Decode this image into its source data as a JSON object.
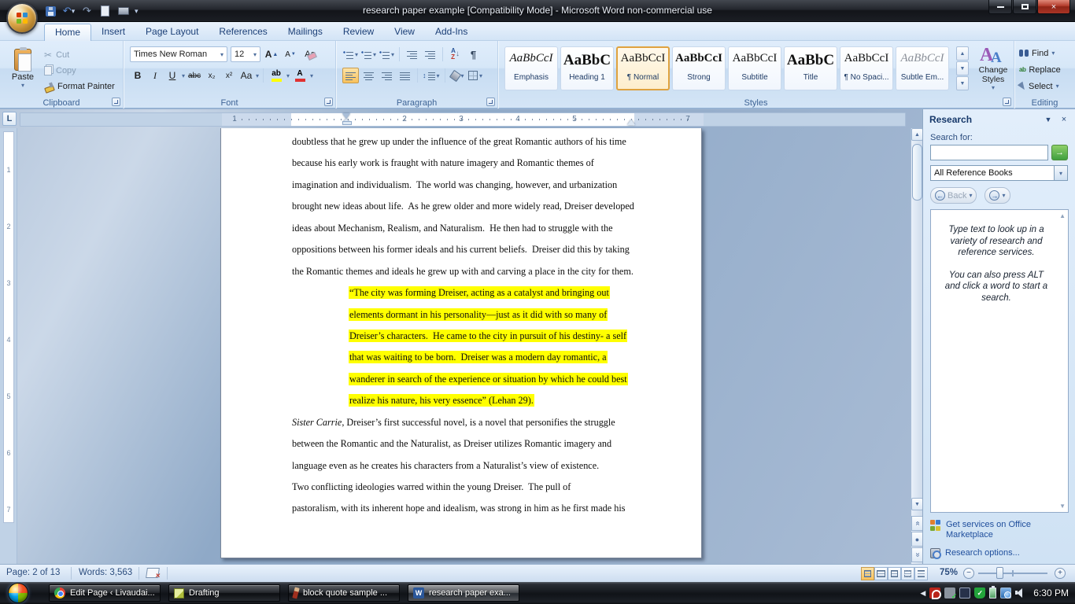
{
  "titlebar": {
    "title": "research paper example [Compatibility Mode] - Microsoft Word non-commercial use"
  },
  "window_controls": {
    "close": "×"
  },
  "icons": {
    "office-button": "office-orb",
    "save": "floppy-disk",
    "undo": "↶",
    "redo": "↷",
    "find": "binoculars",
    "select": "cursor-arrow",
    "go-search": "→",
    "highlight": "ab + yellow bar",
    "font_color": "A + red bar",
    "pilcrow": "¶"
  },
  "ribbon": {
    "tabs": [
      "Home",
      "Insert",
      "Page Layout",
      "References",
      "Mailings",
      "Review",
      "View",
      "Add-Ins"
    ],
    "clipboard": {
      "label": "Clipboard",
      "paste": "Paste",
      "cut": "Cut",
      "copy": "Copy",
      "format_painter": "Format Painter"
    },
    "font": {
      "label": "Font",
      "family": "Times New Roman",
      "size": "12",
      "bold": "B",
      "italic": "I",
      "underline": "U",
      "strike": "abc",
      "subscript": "x₂",
      "superscript": "x²",
      "change_case": "Aa",
      "highlight": "ab",
      "font_color": "A"
    },
    "paragraph": {
      "label": "Paragraph",
      "sort_a": "A",
      "sort_z": "Z",
      "pilcrow": "¶"
    },
    "styles": {
      "label": "Styles",
      "items": [
        {
          "preview": "AaBbCcI",
          "label": "Emphasis"
        },
        {
          "preview": "AaBbC",
          "label": "Heading 1"
        },
        {
          "preview": "AaBbCcI",
          "label": "¶ Normal"
        },
        {
          "preview": "AaBbCcI",
          "label": "Strong"
        },
        {
          "preview": "AaBbCcI",
          "label": "Subtitle"
        },
        {
          "preview": "AaBbC",
          "label": "Title"
        },
        {
          "preview": "AaBbCcI",
          "label": "¶ No Spaci..."
        },
        {
          "preview": "AaBbCcI",
          "label": "Subtle Em..."
        }
      ]
    },
    "change_styles": "Change Styles",
    "editing": {
      "label": "Editing",
      "find": "Find",
      "replace": "Replace",
      "select": "Select"
    }
  },
  "ruler": {
    "tab_selector": "L",
    "h_numbers": [
      "1",
      "2",
      "3",
      "4",
      "5",
      "7"
    ],
    "v_numbers": [
      "1",
      "2",
      "3",
      "4",
      "5",
      "6",
      "7"
    ]
  },
  "document": {
    "body_lines": [
      "doubtless that he grew up under the influence of the great Romantic authors of his time",
      "because his early work is fraught with nature imagery and Romantic themes of",
      "imagination and individualism.  The world was changing, however, and urbanization",
      "brought new ideas about life.  As he grew older and more widely read, Dreiser developed",
      "ideas about Mechanism, Realism, and Naturalism.  He then had to struggle with the",
      "oppositions between his former ideals and his current beliefs.  Dreiser did this by taking",
      "the Romantic themes and ideals he grew up with and carving a place in the city for them."
    ],
    "quote_lines": [
      "“The city was forming Dreiser, acting as a catalyst and bringing out",
      "elements dormant in his personality—just as it did with so many of",
      "Dreiser’s characters.  He came to the city in pursuit of his destiny- a self",
      "that was waiting to be born.  Dreiser was a modern day romantic, a",
      "wanderer in search of the experience or situation by which he could best",
      "realize his nature, his very essence” (Lehan 29)."
    ],
    "para2_italic": "Sister Carrie",
    "para2_rest": ", Dreiser’s first successful novel, is a novel that personifies the struggle",
    "para2_lines": [
      "between the Romantic and the Naturalist, as Dreiser utilizes Romantic imagery and",
      "language even as he creates his characters from a Naturalist’s view of existence."
    ],
    "para3_lines": [
      "Two conflicting ideologies warred within the young Dreiser.  The pull of",
      "pastoralism, with its inherent hope and idealism, was strong in him as he first made his"
    ]
  },
  "research": {
    "title": "Research",
    "search_label": "Search for:",
    "search_value": "",
    "source": "All Reference Books",
    "back": "Back",
    "hint1": "Type text to look up in a variety of research and reference services.",
    "hint2": "You can also press ALT and click a word to start a search.",
    "link_marketplace": "Get services on Office Marketplace",
    "link_options": "Research options..."
  },
  "status": {
    "page": "Page: 2 of 13",
    "words": "Words: 3,563",
    "zoom": "75%"
  },
  "taskbar": {
    "buttons": [
      {
        "label": "Edit Page ‹ Livaudai..."
      },
      {
        "label": "Drafting"
      },
      {
        "label": "block quote sample ..."
      },
      {
        "label": "research paper exa..."
      }
    ],
    "time": "6:30 PM"
  }
}
